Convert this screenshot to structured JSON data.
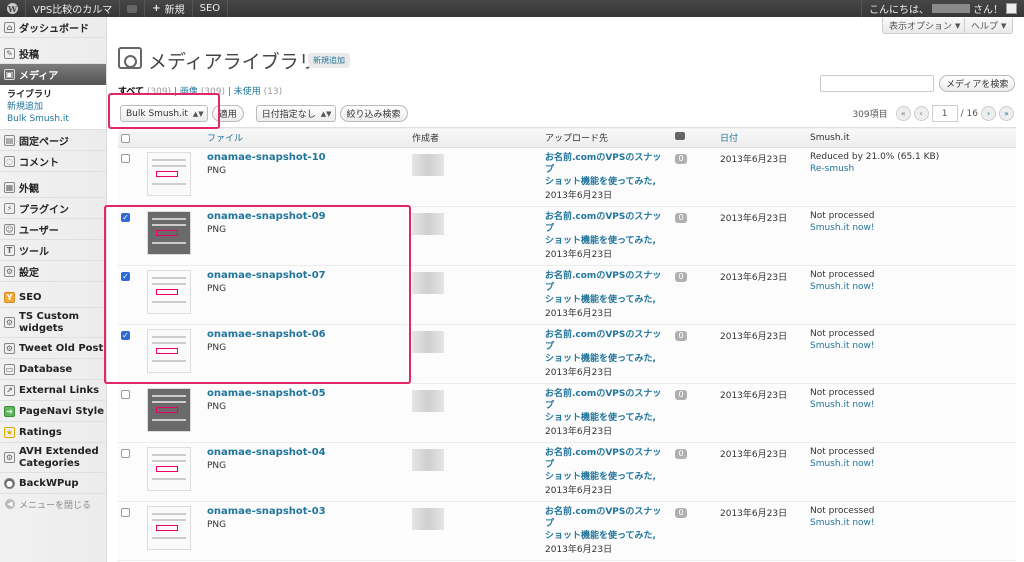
{
  "adminbar": {
    "site_name": "VPS比較のカルマ",
    "new_label": "新規",
    "seo_label": "SEO",
    "greeting_prefix": "こんにちは、",
    "greeting_suffix": "さん！"
  },
  "header": {
    "screen_options": "表示オプション",
    "help": "ヘルプ",
    "title": "メディアライブラリ",
    "add_new": "新規追加"
  },
  "filters": {
    "all_label": "すべて",
    "all_count": "(309)",
    "image_label": "画像",
    "image_count": "(309)",
    "unattached_label": "未使用",
    "unattached_count": "(13)"
  },
  "search": {
    "button": "メディアを検索",
    "value": ""
  },
  "toolbar": {
    "bulk_action": "Bulk Smush.it",
    "apply": "適用",
    "date_filter": "日付指定なし",
    "filter_button": "絞り込み検索"
  },
  "pagination": {
    "items": "309項目",
    "first": "«",
    "prev": "‹",
    "current_page": "1",
    "total_pages": "/ 16",
    "next": "›",
    "last": "»"
  },
  "table": {
    "columns": {
      "file": "ファイル",
      "author": "作成者",
      "uploaded_to": "アップロード先",
      "date": "日付",
      "smush": "Smush.it"
    },
    "rows": [
      {
        "name": "onamae-snapshot-10",
        "type": "PNG",
        "checked": false,
        "dark": false,
        "post_line1": "お名前.comのVPSのスナップ",
        "post_line2": "ショット機能を使ってみた,",
        "post_date": "2013年6月23日",
        "comments": "0",
        "date": "2013年6月23日",
        "status": "Reduced by 21.0% (65.1 KB)",
        "action": "Re-smush"
      },
      {
        "name": "onamae-snapshot-09",
        "type": "PNG",
        "checked": true,
        "dark": true,
        "post_line1": "お名前.comのVPSのスナップ",
        "post_line2": "ショット機能を使ってみた,",
        "post_date": "2013年6月23日",
        "comments": "0",
        "date": "2013年6月23日",
        "status": "Not processed",
        "action": "Smush.it now!"
      },
      {
        "name": "onamae-snapshot-07",
        "type": "PNG",
        "checked": true,
        "dark": false,
        "post_line1": "お名前.comのVPSのスナップ",
        "post_line2": "ショット機能を使ってみた,",
        "post_date": "2013年6月23日",
        "comments": "0",
        "date": "2013年6月23日",
        "status": "Not processed",
        "action": "Smush.it now!"
      },
      {
        "name": "onamae-snapshot-06",
        "type": "PNG",
        "checked": true,
        "dark": false,
        "post_line1": "お名前.comのVPSのスナップ",
        "post_line2": "ショット機能を使ってみた,",
        "post_date": "2013年6月23日",
        "comments": "0",
        "date": "2013年6月23日",
        "status": "Not processed",
        "action": "Smush.it now!"
      },
      {
        "name": "onamae-snapshot-05",
        "type": "PNG",
        "checked": false,
        "dark": true,
        "post_line1": "お名前.comのVPSのスナップ",
        "post_line2": "ショット機能を使ってみた,",
        "post_date": "2013年6月23日",
        "comments": "0",
        "date": "2013年6月23日",
        "status": "Not processed",
        "action": "Smush.it now!"
      },
      {
        "name": "onamae-snapshot-04",
        "type": "PNG",
        "checked": false,
        "dark": false,
        "post_line1": "お名前.comのVPSのスナップ",
        "post_line2": "ショット機能を使ってみた,",
        "post_date": "2013年6月23日",
        "comments": "0",
        "date": "2013年6月23日",
        "status": "Not processed",
        "action": "Smush.it now!"
      },
      {
        "name": "onamae-snapshot-03",
        "type": "PNG",
        "checked": false,
        "dark": false,
        "post_line1": "お名前.comのVPSのスナップ",
        "post_line2": "ショット機能を使ってみた,",
        "post_date": "2013年6月23日",
        "comments": "0",
        "date": "2013年6月23日",
        "status": "Not processed",
        "action": "Smush.it now!"
      }
    ]
  },
  "sidebar": {
    "dashboard": "ダッシュボード",
    "posts": "投稿",
    "media": "メディア",
    "media_library": "ライブラリ",
    "media_add": "新規追加",
    "bulk_smush": "Bulk Smush.it",
    "pages": "固定ページ",
    "comments": "コメント",
    "appearance": "外観",
    "plugins": "プラグイン",
    "users": "ユーザー",
    "tools": "ツール",
    "settings": "設定",
    "seo": "SEO",
    "ts_widgets_1": "TS Custom",
    "ts_widgets_2": "widgets",
    "tweet_old_post": "Tweet Old Post",
    "database": "Database",
    "external_links": "External Links",
    "pagenavi": "PageNavi Style",
    "ratings": "Ratings",
    "avh_1": "AVH Extended",
    "avh_2": "Categories",
    "backwpup": "BackWPup",
    "collapse": "メニューを閉じる"
  }
}
